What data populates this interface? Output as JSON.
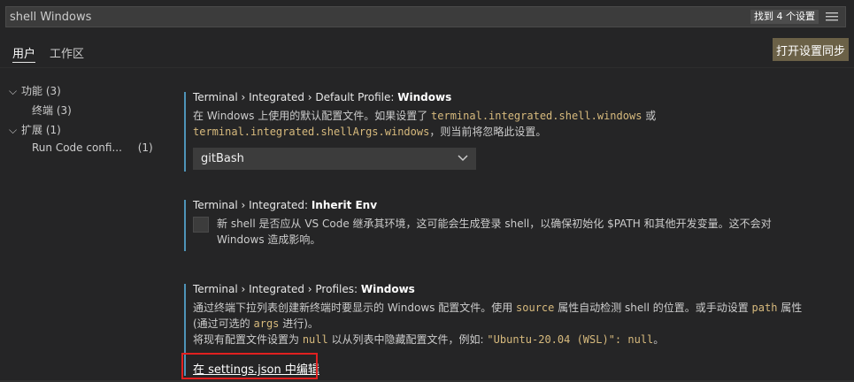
{
  "search": {
    "value": "shell Windows",
    "count_badge": "找到 4 个设置"
  },
  "tabs": [
    {
      "label": "用户"
    },
    {
      "label": "工作区"
    }
  ],
  "sync_button": "打开设置同步",
  "toc": [
    {
      "label": "功能",
      "count": "(3)"
    },
    {
      "label": "终端",
      "count": "(3)"
    },
    {
      "label": "扩展",
      "count": "(1)"
    },
    {
      "label": "Run Code confi...",
      "count": "(1)"
    }
  ],
  "settings": {
    "default_profile": {
      "category": "Terminal › Integrated › Default Profile: ",
      "name": "Windows",
      "desc_1": "在 Windows 上使用的默认配置文件。如果设置了 ",
      "code_1": "terminal.integrated.shell.windows",
      "desc_2": " 或",
      "code_2": "terminal.integrated.shellArgs.windows",
      "desc_3": "，则当前将忽略此设置。",
      "selected": "gitBash"
    },
    "inherit_env": {
      "category": "Terminal › Integrated: ",
      "name": "Inherit Env",
      "desc_line1": "新 shell 是否应从 VS Code 继承其环境，这可能会生成登录 shell，以确保初始化 $PATH 和其他开发变量。这不会对",
      "desc_line2": "Windows 造成影响。"
    },
    "profiles_windows": {
      "category": "Terminal › Integrated › Profiles: ",
      "name": "Windows",
      "l1_a": "通过终端下拉列表创建新终端时要显示的 Windows 配置文件。使用 ",
      "l1_code1": "source",
      "l1_b": " 属性自动检测 shell 的位置。或手动设置 ",
      "l1_code2": "path",
      "l1_c": " 属性",
      "l2_a": "(通过可选的 ",
      "l2_code": "args",
      "l2_b": " 进行)。",
      "l3_a": "将现有配置文件设置为 ",
      "l3_code1": "null",
      "l3_b": " 以从列表中隐藏配置文件，例如: ",
      "l3_code2": "\"Ubuntu-20.04 (WSL)\": null",
      "l3_c": "。",
      "edit_link": "在 settings.json 中编辑"
    }
  },
  "colors": {
    "accent_bar": "#4e94b8",
    "sync_button_bg": "#6b6147",
    "highlight": "#e02020"
  }
}
